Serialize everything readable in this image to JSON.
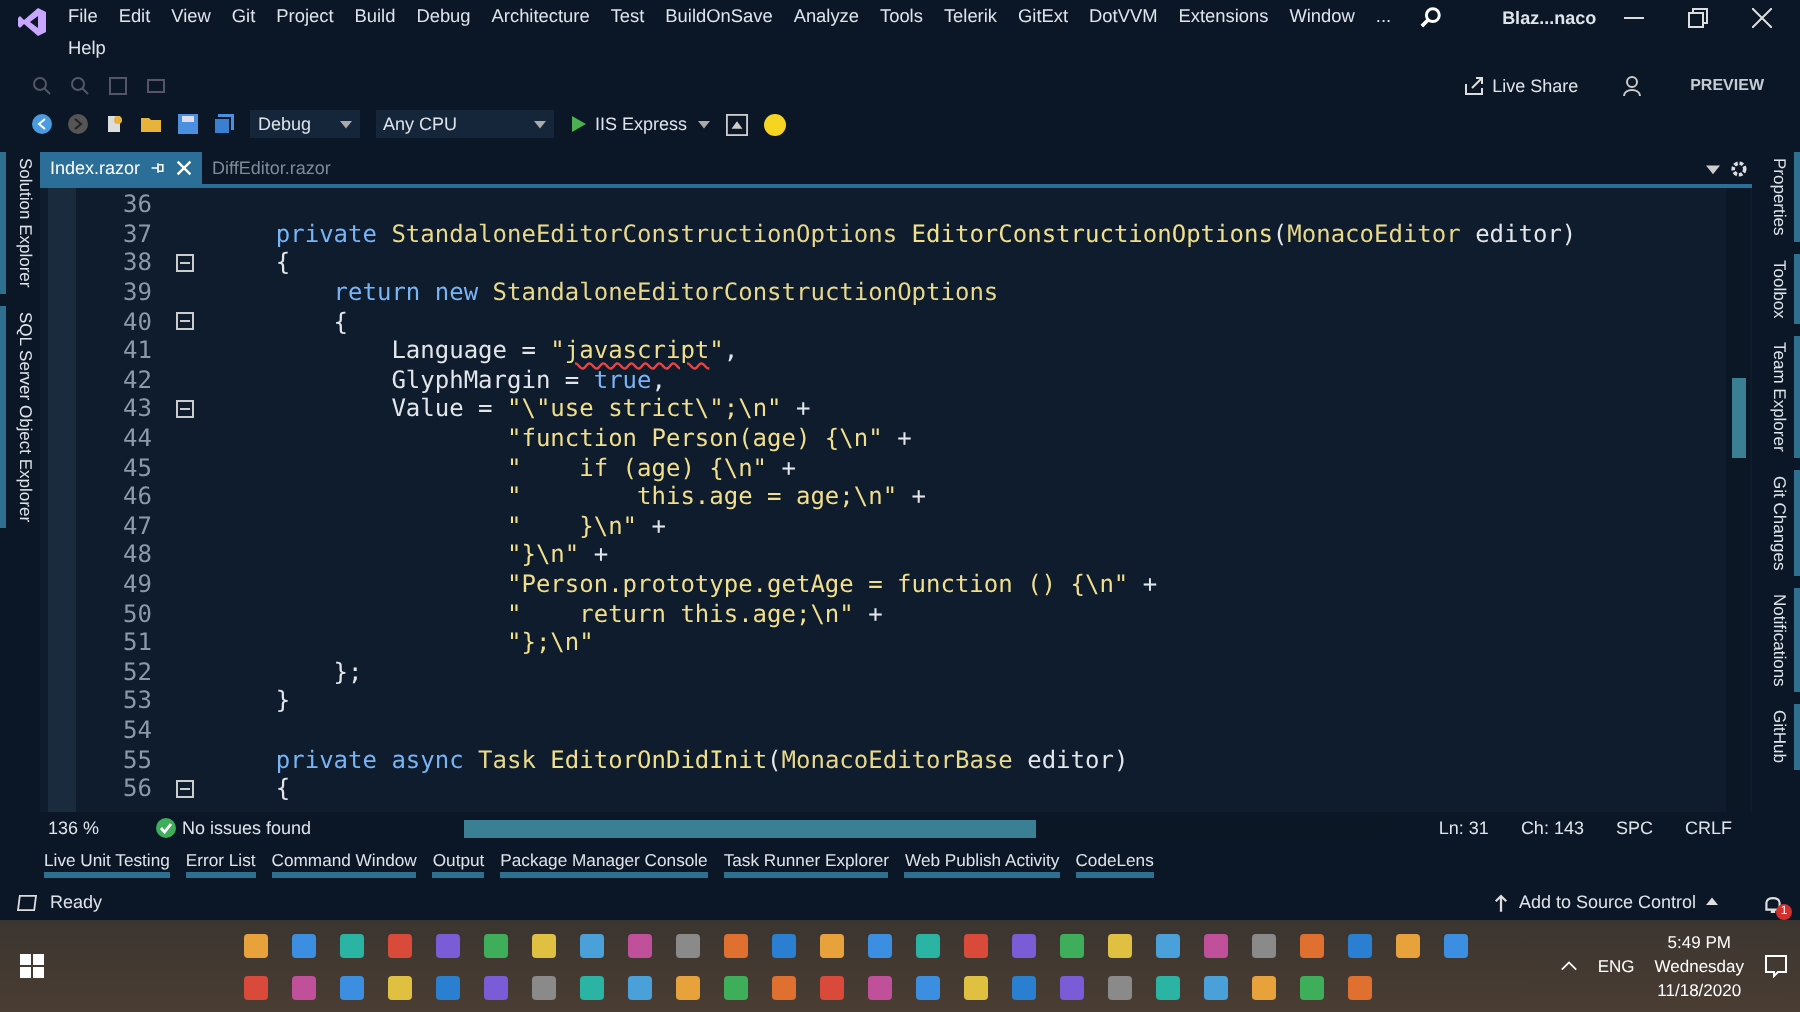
{
  "window": {
    "title": "Blaz...naco"
  },
  "menu_rows": [
    [
      "File",
      "Edit",
      "View",
      "Git",
      "Project",
      "Build",
      "Debug",
      "Architecture",
      "Test",
      "BuildOnSave",
      "Analyze",
      "Tools",
      "Telerik",
      "GitExt",
      "DotVVM",
      "Extensions",
      "Window",
      "..."
    ],
    [
      "Help"
    ]
  ],
  "toolbar": {
    "configuration": "Debug",
    "platform": "Any CPU",
    "run_target": "IIS Express",
    "live_share": "Live Share",
    "preview": "PREVIEW"
  },
  "left_panels": [
    "Solution Explorer",
    "SQL Server Object Explorer"
  ],
  "right_panels": [
    "Properties",
    "Toolbox",
    "Team Explorer",
    "Git Changes",
    "Notifications",
    "GitHub"
  ],
  "document_tabs": [
    {
      "label": "Index.razor",
      "selected": true
    },
    {
      "label": "DiffEditor.razor",
      "selected": false
    }
  ],
  "code_lines": [
    {
      "number": "36",
      "fold": false
    },
    {
      "number": "37",
      "fold": false,
      "tokens": [
        {
          "kind": "keyword",
          "text": "    private "
        },
        {
          "kind": "type",
          "text": "StandaloneEditorConstructionOptions "
        },
        {
          "kind": "method",
          "text": "EditorConstructionOptions"
        },
        {
          "kind": "plain",
          "text": "("
        },
        {
          "kind": "type",
          "text": "MonacoEditor"
        },
        {
          "kind": "plain",
          "text": " editor)"
        }
      ]
    },
    {
      "number": "38",
      "fold": true,
      "tokens": [
        {
          "kind": "plain",
          "text": "    {"
        }
      ]
    },
    {
      "number": "39",
      "fold": false,
      "tokens": [
        {
          "kind": "keyword",
          "text": "        return new "
        },
        {
          "kind": "type",
          "text": "StandaloneEditorConstructionOptions"
        }
      ]
    },
    {
      "number": "40",
      "fold": true,
      "tokens": [
        {
          "kind": "plain",
          "text": "        {"
        }
      ]
    },
    {
      "number": "41",
      "fold": false,
      "tokens": [
        {
          "kind": "plain",
          "text": "            Language = "
        },
        {
          "kind": "string",
          "text": "\""
        },
        {
          "kind": "misspelled",
          "text": "javascript"
        },
        {
          "kind": "string",
          "text": "\""
        },
        {
          "kind": "plain",
          "text": ","
        }
      ]
    },
    {
      "number": "42",
      "fold": false,
      "tokens": [
        {
          "kind": "plain",
          "text": "            GlyphMargin = "
        },
        {
          "kind": "keyword",
          "text": "true"
        },
        {
          "kind": "plain",
          "text": ","
        }
      ]
    },
    {
      "number": "43",
      "fold": true,
      "tokens": [
        {
          "kind": "plain",
          "text": "            Value = "
        },
        {
          "kind": "string",
          "text": "\"\\\"use strict\\\";\\n\""
        },
        {
          "kind": "plain",
          "text": " +"
        }
      ]
    },
    {
      "number": "44",
      "fold": false,
      "tokens": [
        {
          "kind": "string",
          "text": "                    \"function Person(age) {\\n\""
        },
        {
          "kind": "plain",
          "text": " +"
        }
      ]
    },
    {
      "number": "45",
      "fold": false,
      "tokens": [
        {
          "kind": "string",
          "text": "                    \"    if (age) {\\n\""
        },
        {
          "kind": "plain",
          "text": " +"
        }
      ]
    },
    {
      "number": "46",
      "fold": false,
      "tokens": [
        {
          "kind": "string",
          "text": "                    \"        this.age = age;\\n\""
        },
        {
          "kind": "plain",
          "text": " +"
        }
      ]
    },
    {
      "number": "47",
      "fold": false,
      "tokens": [
        {
          "kind": "string",
          "text": "                    \"    }\\n\""
        },
        {
          "kind": "plain",
          "text": " +"
        }
      ]
    },
    {
      "number": "48",
      "fold": false,
      "tokens": [
        {
          "kind": "string",
          "text": "                    \"}\\n\""
        },
        {
          "kind": "plain",
          "text": " +"
        }
      ]
    },
    {
      "number": "49",
      "fold": false,
      "tokens": [
        {
          "kind": "string",
          "text": "                    \"Person.prototype.getAge = function () {\\n\""
        },
        {
          "kind": "plain",
          "text": " +"
        }
      ]
    },
    {
      "number": "50",
      "fold": false,
      "tokens": [
        {
          "kind": "string",
          "text": "                    \"    return this.age;\\n\""
        },
        {
          "kind": "plain",
          "text": " +"
        }
      ]
    },
    {
      "number": "51",
      "fold": false,
      "tokens": [
        {
          "kind": "string",
          "text": "                    \"};\\n\""
        }
      ]
    },
    {
      "number": "52",
      "fold": false,
      "tokens": [
        {
          "kind": "plain",
          "text": "        };"
        }
      ]
    },
    {
      "number": "53",
      "fold": false,
      "tokens": [
        {
          "kind": "plain",
          "text": "    }"
        }
      ]
    },
    {
      "number": "54",
      "fold": false
    },
    {
      "number": "55",
      "fold": false,
      "tokens": [
        {
          "kind": "keyword",
          "text": "    private async "
        },
        {
          "kind": "type",
          "text": "Task "
        },
        {
          "kind": "method",
          "text": "EditorOnDidInit"
        },
        {
          "kind": "plain",
          "text": "("
        },
        {
          "kind": "type",
          "text": "MonacoEditorBase"
        },
        {
          "kind": "plain",
          "text": " editor)"
        }
      ]
    },
    {
      "number": "56",
      "fold": true,
      "tokens": [
        {
          "kind": "plain",
          "text": "    {"
        }
      ]
    }
  ],
  "editor_status": {
    "zoom": "136 %",
    "issues": "No issues found",
    "line": "Ln: 31",
    "column": "Ch: 143",
    "whitespace": "SPC",
    "line_ending": "CRLF"
  },
  "tool_tabs": [
    "Live Unit Testing",
    "Error List",
    "Command Window",
    "Output",
    "Package Manager Console",
    "Task Runner Explorer",
    "Web Publish Activity",
    "CodeLens"
  ],
  "status_bar": {
    "state": "Ready",
    "source_control": "Add to Source Control",
    "notifications": "1"
  },
  "taskbar": {
    "language": "ENG",
    "time": "5:49 PM",
    "day": "Wednesday",
    "date": "11/18/2020"
  }
}
